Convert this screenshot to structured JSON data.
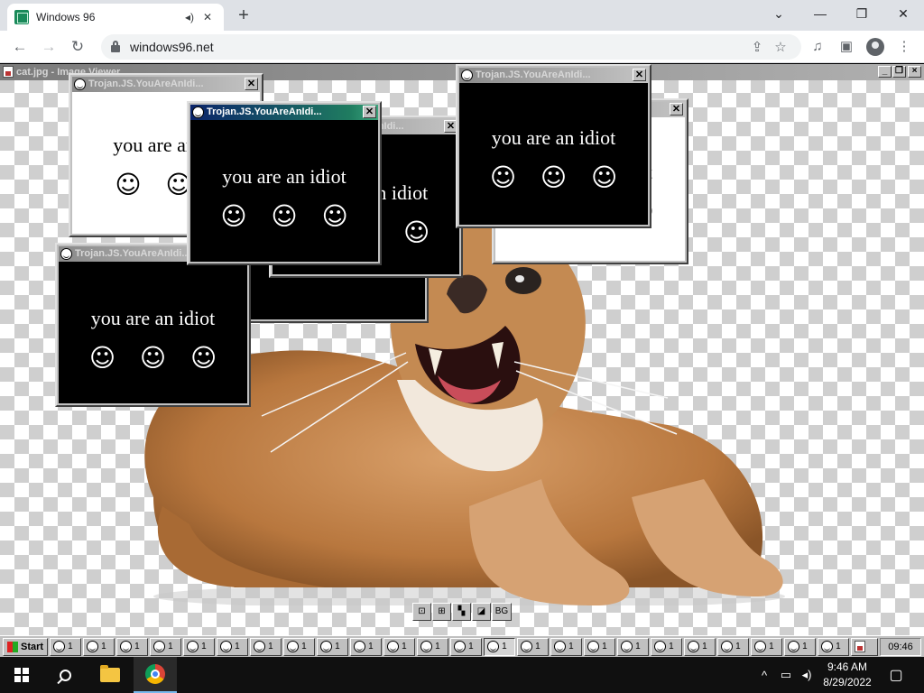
{
  "browser": {
    "tab_title": "Windows 96",
    "url": "windows96.net"
  },
  "viewer": {
    "title": "cat.jpg - Image Viewer",
    "tools": [
      "",
      "",
      "",
      "",
      "BG"
    ]
  },
  "popups": {
    "title_full": "Trojan.JS.YouAreAnIdiot",
    "title_short": "Trojan.JS.YouAreAnIdi...",
    "message": "you are an idiot",
    "faces": "☺ ☺ ☺"
  },
  "w96_taskbar": {
    "start_label": "Start",
    "task_label": "1",
    "clock": "09:46"
  },
  "win10": {
    "time": "9:46 AM",
    "date": "8/29/2022"
  },
  "icons": [
    "sound-icon",
    "close-icon",
    "plus-icon",
    "back-arrow-icon",
    "forward-arrow-icon",
    "reload-icon",
    "lock-icon",
    "share-icon",
    "star-icon",
    "media-icon",
    "side-panel-icon",
    "profile-icon",
    "more-icon",
    "smiley-icon",
    "windows-logo-icon",
    "search-icon",
    "folder-icon",
    "chrome-icon",
    "network-icon",
    "volume-icon",
    "notification-icon"
  ]
}
